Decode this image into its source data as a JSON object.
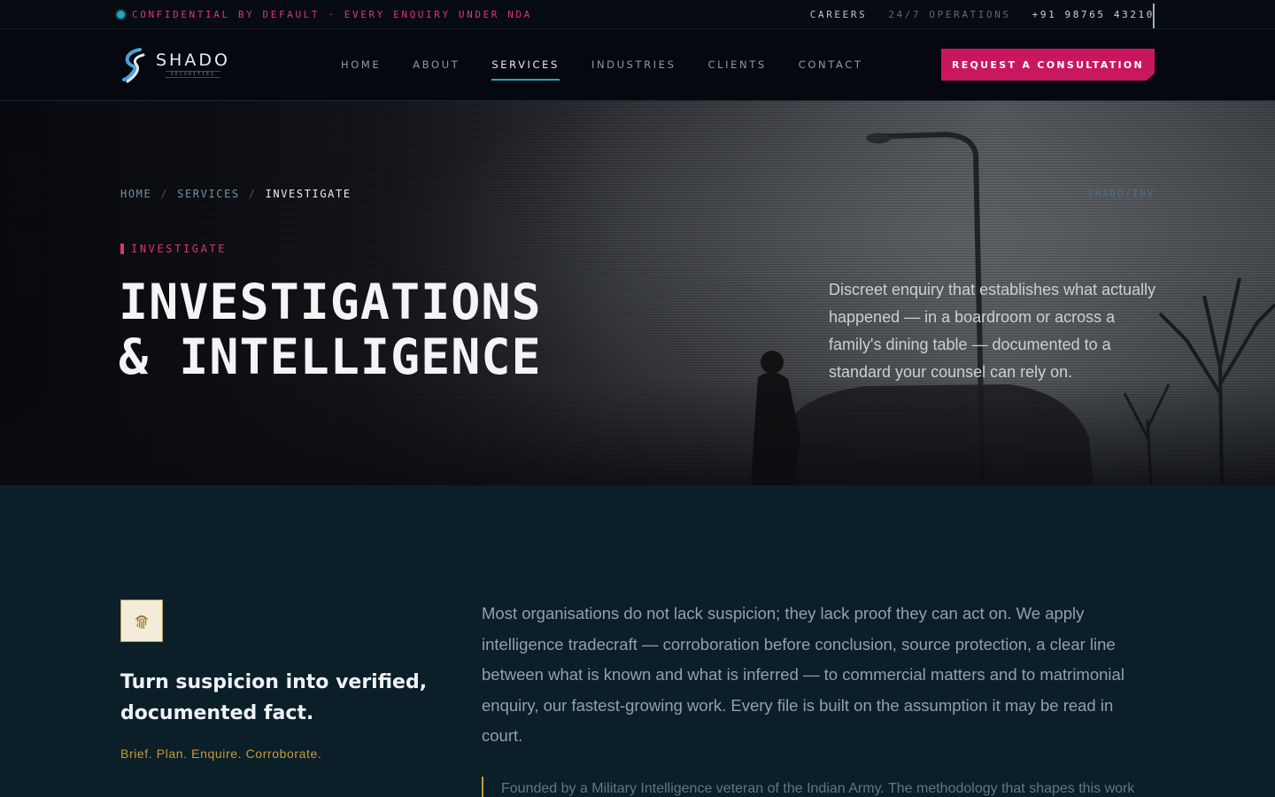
{
  "topbar": {
    "notice": "CONFIDENTIAL BY DEFAULT · EVERY ENQUIRY UNDER NDA",
    "careers": "CAREERS",
    "operations": "24/7 OPERATIONS",
    "phone": "+91 98765 43210"
  },
  "brand": {
    "name": "SHADO",
    "tagline": "SECURITIES"
  },
  "nav": {
    "items": [
      {
        "label": "HOME"
      },
      {
        "label": "ABOUT"
      },
      {
        "label": "SERVICES"
      },
      {
        "label": "INDUSTRIES"
      },
      {
        "label": "CLIENTS"
      },
      {
        "label": "CONTACT"
      }
    ],
    "active": "SERVICES",
    "cta": "REQUEST A CONSULTATION"
  },
  "hero": {
    "breadcrumb": {
      "home": "HOME",
      "sep": "/",
      "services": "SERVICES",
      "current": "INVESTIGATE"
    },
    "code": "SHADO/INV",
    "eyebrow": "INVESTIGATE",
    "title_line1": "INVESTIGATIONS",
    "title_line2": "& INTELLIGENCE",
    "description": "Discreet enquiry that establishes what actually happened — in a boardroom or across a family's dining table — documented to a standard your counsel can rely on."
  },
  "section": {
    "icon": "fingerprint-icon",
    "heading": "Turn suspicion into verified, documented fact.",
    "motto": "Brief. Plan. Enquire. Corroborate.",
    "body": "Most organisations do not lack suspicion; they lack proof they can act on. We apply intelligence tradecraft — corroboration before conclusion, source protection, a clear line between what is known and what is inferred — to commercial matters and to matrimonial enquiry, our fastest-growing work. Every file is built on the assumption it may be read in court.",
    "quote": "Founded by a Military Intelligence veteran of the Indian Army. The methodology that shapes this work"
  },
  "colors": {
    "accent_pink": "#c8175f",
    "accent_teal": "#2aa6b8",
    "accent_gold": "#c79a3b",
    "section_bg": "#0b1f29"
  }
}
